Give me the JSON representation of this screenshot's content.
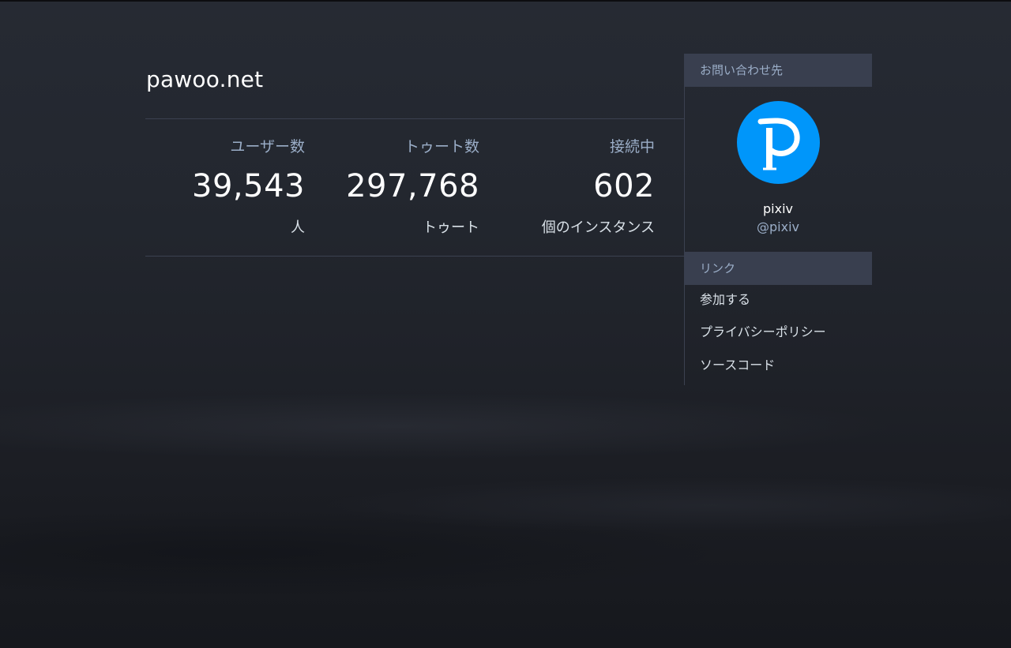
{
  "site": {
    "title": "pawoo.net"
  },
  "stats": [
    {
      "label": "ユーザー数",
      "value": "39,543",
      "unit": "人"
    },
    {
      "label": "トゥート数",
      "value": "297,768",
      "unit": "トゥート"
    },
    {
      "label": "接続中",
      "value": "602",
      "unit": "個のインスタンス"
    }
  ],
  "sidebar": {
    "contact_header": "お問い合わせ先",
    "contact": {
      "name": "pixiv",
      "handle": "@pixiv",
      "avatar_icon": "pixiv-logo-icon"
    },
    "links_header": "リンク",
    "links": [
      {
        "label": "参加する"
      },
      {
        "label": "プライバシーポリシー"
      },
      {
        "label": "ソースコード"
      }
    ]
  },
  "colors": {
    "accent_blue": "#0096fa",
    "muted_text": "#9baec8",
    "header_bg": "#393f4f"
  }
}
